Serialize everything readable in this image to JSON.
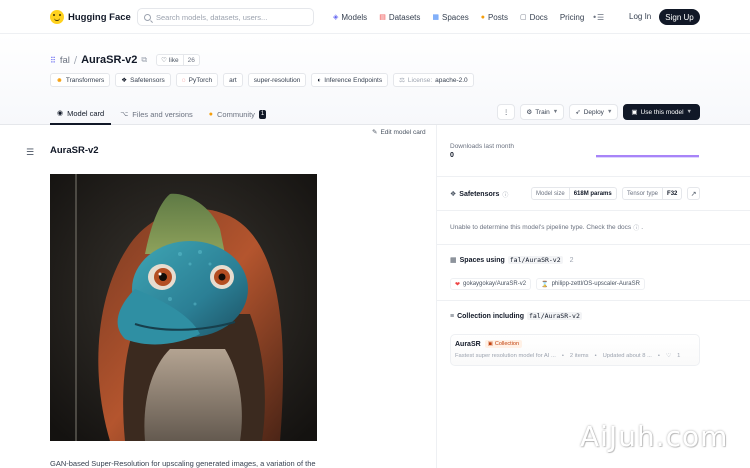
{
  "nav": {
    "brand": "Hugging Face",
    "search_placeholder": "Search models, datasets, users...",
    "links": [
      {
        "label": "Models",
        "icon": "cube-icon"
      },
      {
        "label": "Datasets",
        "icon": "database-icon"
      },
      {
        "label": "Spaces",
        "icon": "spaces-icon"
      },
      {
        "label": "Posts",
        "icon": "posts-icon"
      },
      {
        "label": "Docs",
        "icon": "docs-icon"
      },
      {
        "label": "Pricing",
        "icon": ""
      }
    ],
    "login": "Log In",
    "signup": "Sign Up"
  },
  "repo": {
    "org": "fal",
    "name": "AuraSR-v2",
    "like_label": "like",
    "like_count": "26"
  },
  "tags": [
    {
      "label": "Transformers",
      "icon": "transformers-icon"
    },
    {
      "label": "Safetensors",
      "icon": "safetensors-icon"
    },
    {
      "label": "PyTorch",
      "icon": "pytorch-icon"
    },
    {
      "label": "art",
      "icon": ""
    },
    {
      "label": "super-resolution",
      "icon": ""
    },
    {
      "label": "Inference Endpoints",
      "icon": "endpoints-icon"
    }
  ],
  "license": {
    "key": "License:",
    "value": "apache-2.0"
  },
  "tabs": [
    {
      "label": "Model card",
      "active": true
    },
    {
      "label": "Files and versions",
      "active": false
    },
    {
      "label": "Community",
      "badge": "1",
      "active": false
    }
  ],
  "actions": {
    "more": "⋮",
    "train": "Train",
    "deploy": "Deploy",
    "use": "Use this model"
  },
  "main": {
    "edit_label": "Edit model card",
    "heading": "AuraSR-v2",
    "intro_text": "GAN-based Super-Resolution for upscaling generated images, a variation of the"
  },
  "sidebar": {
    "downloads_label": "Downloads last month",
    "downloads_value": "0",
    "safetensors_label": "Safetensors",
    "model_size_key": "Model size",
    "model_size_value": "618M params",
    "tensor_type_key": "Tensor type",
    "tensor_type_value": "F32",
    "pipeline_note": "Unable to determine this model's pipeline type. Check the docs",
    "pipeline_end": ".",
    "spaces_prefix": "Spaces using",
    "spaces_repo": "fal/AuraSR-v2",
    "spaces_count": "2",
    "spaces": [
      "gokaygokay/AuraSR-v2",
      "philipp-zettl/OS-upscaler-AuraSR"
    ],
    "collection_prefix": "Collection including",
    "collection_repo": "fal/AuraSR-v2",
    "collection": {
      "name": "AuraSR",
      "badge": "Collection",
      "desc": "Fastest super resolution model for AI ...",
      "items": "2 items",
      "updated": "Updated about 8 ...",
      "likes": "1"
    }
  },
  "watermark": "AiJuh.com",
  "colors": {
    "accent": "#8b5cf6",
    "dark_button": "#111827",
    "brand_yellow": "#ffd21e"
  }
}
